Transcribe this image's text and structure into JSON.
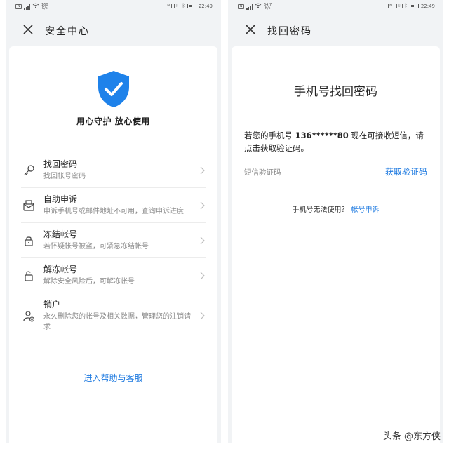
{
  "left": {
    "status": {
      "net_speed_top": "160",
      "net_speed_bottom": "K/s",
      "time": "22:49"
    },
    "title": "安全中心",
    "slogan": "用心守护   放心使用",
    "menu": [
      {
        "icon": "key-icon",
        "title": "找回密码",
        "desc": "找回帐号密码"
      },
      {
        "icon": "mail-appeal-icon",
        "title": "自助申诉",
        "desc": "申诉手机号或邮件地址不可用，查询申诉进度"
      },
      {
        "icon": "lock-icon",
        "title": "冻结帐号",
        "desc": "若怀疑帐号被盗，可紧急冻结帐号"
      },
      {
        "icon": "unlock-icon",
        "title": "解冻帐号",
        "desc": "解除安全风险后，可解冻帐号"
      },
      {
        "icon": "user-remove-icon",
        "title": "销户",
        "desc": "永久删除您的帐号及相关数据，管理您的注销请求"
      }
    ],
    "help_link": "进入帮助与客服"
  },
  "right": {
    "status": {
      "net_speed_top": "64.7",
      "net_speed_bottom": "K/s",
      "time": "22:49"
    },
    "title": "找回密码",
    "heading": "手机号找回密码",
    "info_prefix": "若您的手机号 ",
    "phone_masked": "136******80",
    "info_suffix": " 现在可接收短信，请点击获取验证码。",
    "sms_placeholder": "短信验证码",
    "get_code": "获取验证码",
    "unavailable_text": "手机号无法使用？",
    "appeal_link": "帐号申诉"
  },
  "watermark": "头条 @东方侠",
  "colors": {
    "accent": "#1e7ae0",
    "background": "#f1f3f5",
    "card": "#ffffff"
  }
}
